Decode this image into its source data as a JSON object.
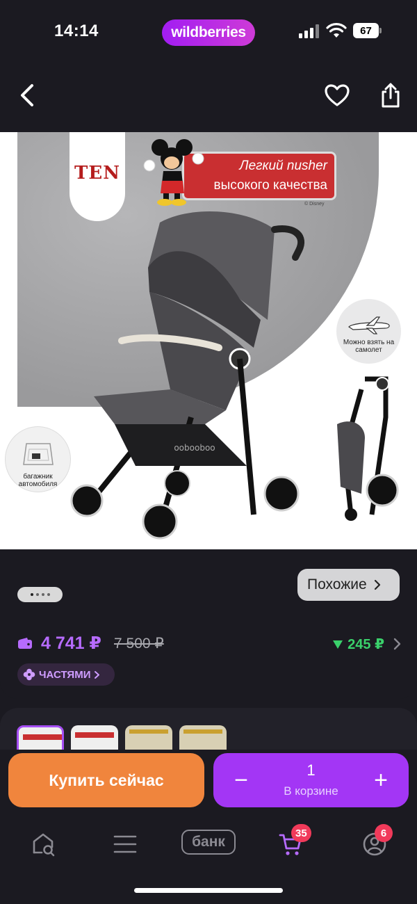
{
  "status_bar": {
    "time": "14:14",
    "brand": "wildberries",
    "battery": "67",
    "icons": [
      "signal-icon",
      "wifi-icon",
      "battery-icon"
    ]
  },
  "nav": {
    "icons": [
      "back-chevron-icon",
      "heart-icon",
      "share-icon"
    ]
  },
  "product_image": {
    "brand_logo": "TEN",
    "banner_line1": "Легкий nusher",
    "banner_line2": "высокого качества",
    "disney": "© Disney",
    "airplane_badge": "Можно взять на самолет",
    "trunk_badge": "багажник автомобиля",
    "stroller_brand": "oobooboo"
  },
  "carousel": {
    "dots_total": 4,
    "active_dot": 1
  },
  "similar_button": {
    "label": "Похожие"
  },
  "price": {
    "current": "4 741 ₽",
    "old": "7 500 ₽",
    "cashback": "245 ₽"
  },
  "installments": {
    "label": "ЧАСТЯМИ"
  },
  "actions": {
    "buy_now": "Купить сейчас",
    "quantity": "1",
    "in_cart": "В корзине",
    "minus": "−",
    "plus": "+"
  },
  "tab_bar": {
    "bank": "банк",
    "cart_badge": "35",
    "profile_badge": "6",
    "icons": [
      "home-search-icon",
      "menu-icon",
      "cart-icon",
      "profile-icon"
    ]
  },
  "colors": {
    "background": "#1b1a21",
    "brand_gradient_start": "#a21df2",
    "brand_gradient_end": "#ce3bd7",
    "price": "#b66bfd",
    "cashback": "#3ad06b",
    "buy_button": "#f0853d",
    "cart_button": "#a336f5",
    "badge": "#f13a5a"
  }
}
